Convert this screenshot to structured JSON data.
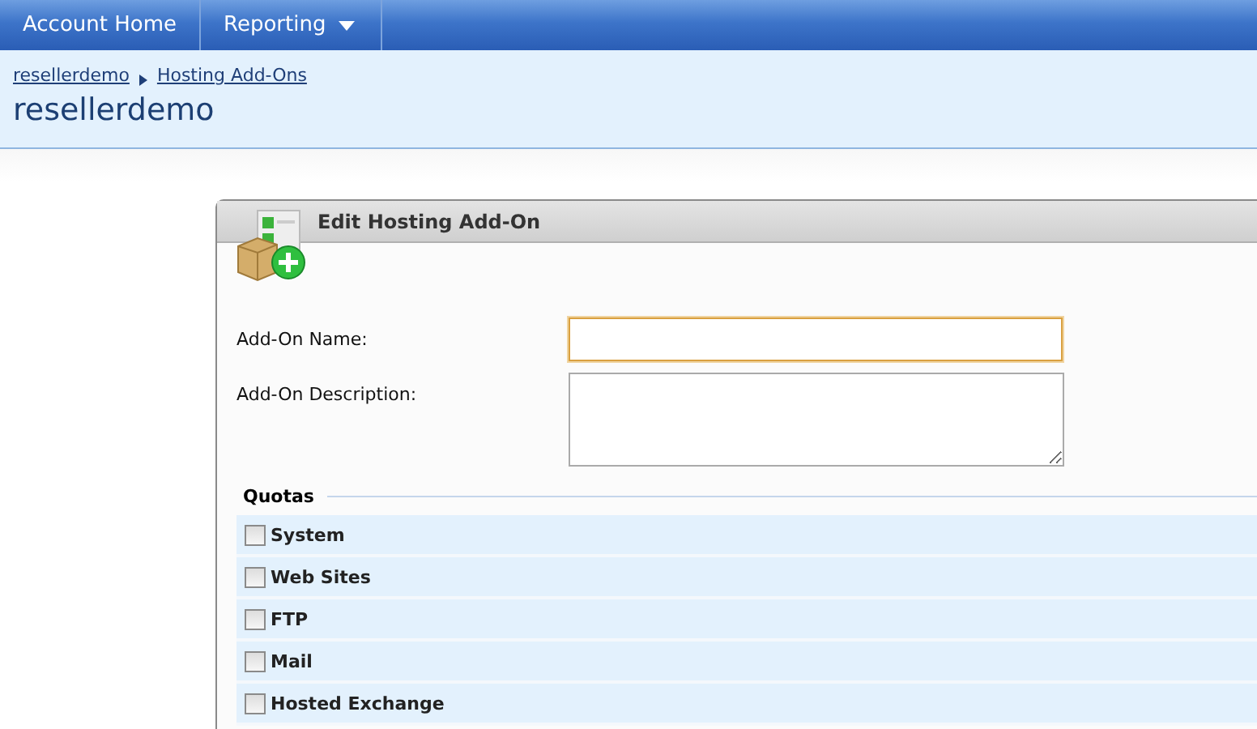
{
  "nav": {
    "items": [
      {
        "label": "Account Home",
        "has_menu": false
      },
      {
        "label": "Reporting",
        "has_menu": true
      }
    ]
  },
  "header": {
    "breadcrumb": [
      "resellerdemo",
      "Hosting Add-Ons"
    ],
    "title": "resellerdemo"
  },
  "panel": {
    "title": "Edit Hosting Add-On",
    "fields": [
      {
        "kind": "text",
        "label": "Add-On Name:",
        "focused": true
      },
      {
        "kind": "textarea",
        "label": "Add-On Description:",
        "focused": false
      }
    ],
    "quotas": {
      "title": "Quotas",
      "groups": [
        {
          "label": "System",
          "checked": false
        },
        {
          "label": "Web Sites",
          "checked": false
        },
        {
          "label": "FTP",
          "checked": false
        },
        {
          "label": "Mail",
          "checked": false
        },
        {
          "label": "Hosted Exchange",
          "checked": false
        }
      ]
    }
  }
}
